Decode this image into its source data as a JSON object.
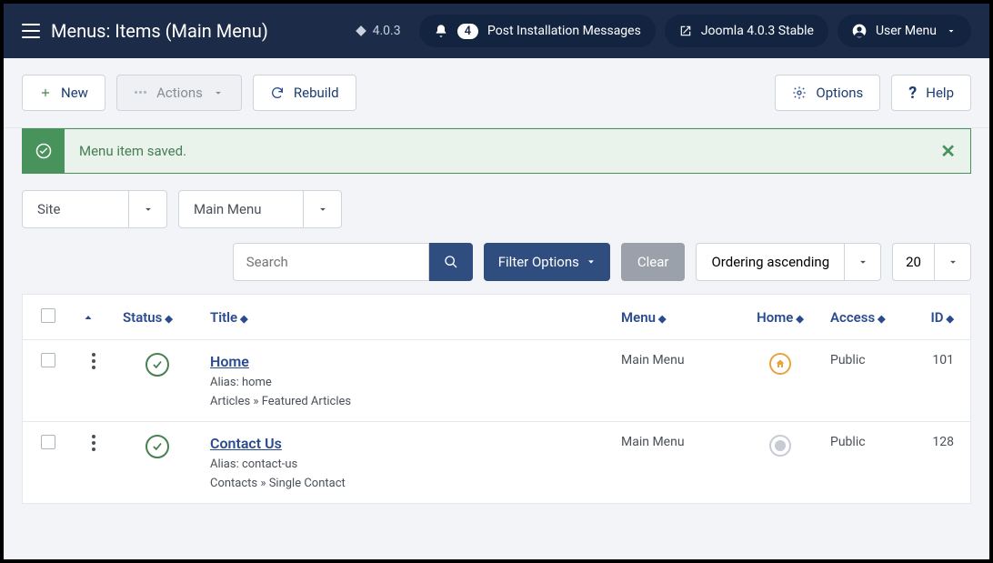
{
  "header": {
    "title": "Menus: Items (Main Menu)",
    "version": "4.0.3",
    "notifications_count": "4",
    "notifications_label": "Post Installation Messages",
    "joomla_label": "Joomla 4.0.3 Stable",
    "user_menu_label": "User Menu"
  },
  "toolbar": {
    "new": "New",
    "actions": "Actions",
    "rebuild": "Rebuild",
    "options": "Options",
    "help": "Help"
  },
  "alert": {
    "message": "Menu item saved."
  },
  "selectors": {
    "client": "Site",
    "menu": "Main Menu"
  },
  "filters": {
    "search_placeholder": "Search",
    "filter_options": "Filter Options",
    "clear": "Clear",
    "ordering": "Ordering ascending",
    "limit": "20"
  },
  "columns": {
    "status": "Status",
    "title": "Title",
    "menu": "Menu",
    "home": "Home",
    "access": "Access",
    "id": "ID"
  },
  "rows": [
    {
      "title": "Home",
      "alias": "Alias: home",
      "type": "Articles » Featured Articles",
      "menu": "Main Menu",
      "home": true,
      "access": "Public",
      "id": "101"
    },
    {
      "title": "Contact Us",
      "alias": "Alias: contact-us",
      "type": "Contacts » Single Contact",
      "menu": "Main Menu",
      "home": false,
      "access": "Public",
      "id": "128"
    }
  ]
}
